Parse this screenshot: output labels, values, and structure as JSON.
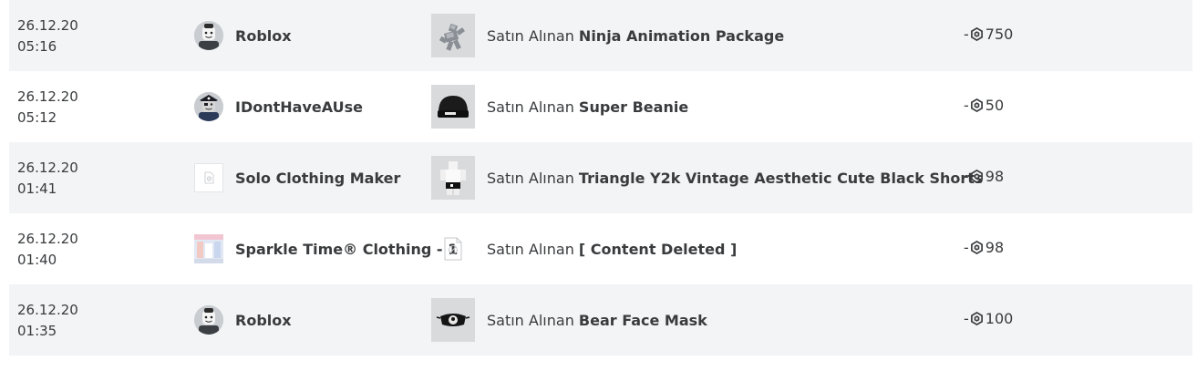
{
  "transactions": [
    {
      "date": "26.12.20",
      "time": "05:16",
      "seller": "Roblox",
      "seller_icon": "roblox-avatar-icon",
      "item_prefix": "Satın Alınan",
      "item_name": "Ninja Animation Package",
      "item_icon": "ninja-animation-thumbnail",
      "amount_sign": "-",
      "amount": "750"
    },
    {
      "date": "26.12.20",
      "time": "05:12",
      "seller": "IDontHaveAUse",
      "seller_icon": "pirate-avatar-icon",
      "item_prefix": "Satın Alınan",
      "item_name": "Super Beanie",
      "item_icon": "beanie-thumbnail",
      "amount_sign": "-",
      "amount": "50"
    },
    {
      "date": "26.12.20",
      "time": "01:41",
      "seller": "Solo Clothing Maker",
      "seller_icon": "broken-image-icon",
      "item_prefix": "Satın Alınan",
      "item_name": "Triangle Y2k Vintage Aesthetic Cute Black Shorts",
      "item_icon": "shorts-thumbnail",
      "amount_sign": "-",
      "amount": "98"
    },
    {
      "date": "26.12.20",
      "time": "01:40",
      "seller": "Sparkle Time® Clothing - 1",
      "seller_icon": "sparkle-group-icon",
      "item_prefix": "Satın Alınan",
      "item_name": "[ Content Deleted ]",
      "item_icon": "content-deleted-icon",
      "amount_sign": "-",
      "amount": "98"
    },
    {
      "date": "26.12.20",
      "time": "01:35",
      "seller": "Roblox",
      "seller_icon": "roblox-avatar-icon",
      "item_prefix": "Satın Alınan",
      "item_name": "Bear Face Mask",
      "item_icon": "bear-mask-thumbnail",
      "amount_sign": "-",
      "amount": "100"
    }
  ],
  "colors": {
    "row_shade": "#f2f4f5",
    "text": "#393b3d",
    "thumb_bg": "#d8dadc"
  }
}
